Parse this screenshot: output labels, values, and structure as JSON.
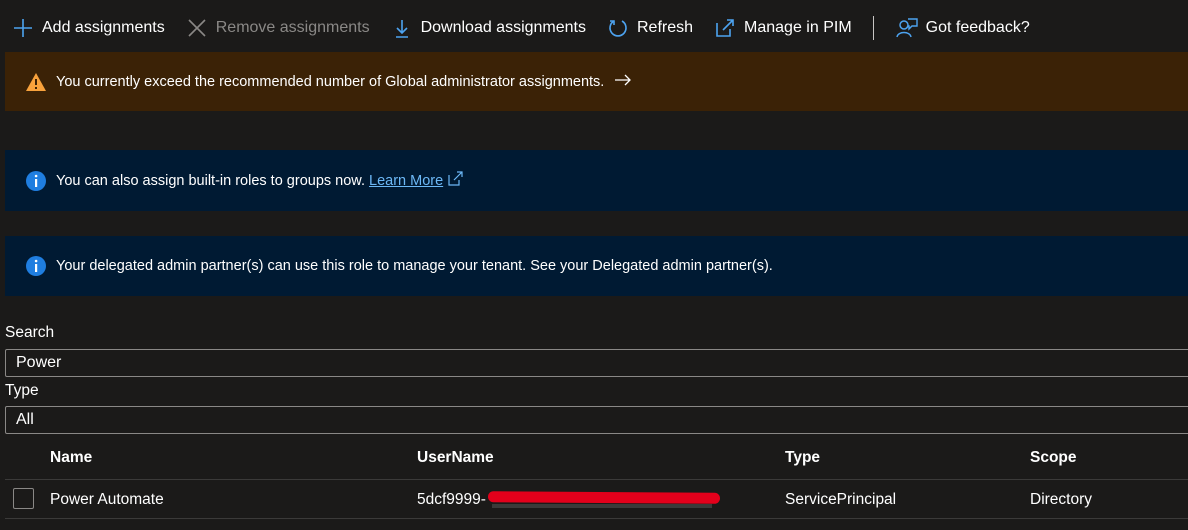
{
  "toolbar": {
    "add": "Add assignments",
    "remove": "Remove assignments",
    "download": "Download assignments",
    "refresh": "Refresh",
    "pim": "Manage in PIM",
    "feedback": "Got feedback?"
  },
  "banners": {
    "warning": "You currently exceed the recommended number of Global administrator assignments.",
    "groups_text": "You can also assign built-in roles to groups now.",
    "groups_link": "Learn More",
    "delegated": "Your delegated admin partner(s) can use this role to manage your tenant. See your Delegated admin partner(s)."
  },
  "filters": {
    "search_label": "Search",
    "search_value": "Power",
    "type_label": "Type",
    "type_value": "All"
  },
  "table": {
    "columns": [
      "Name",
      "UserName",
      "Type",
      "Scope"
    ],
    "rows": [
      {
        "name": "Power Automate",
        "username": "5dcf9999-",
        "type": "ServicePrincipal",
        "scope": "Directory"
      }
    ]
  },
  "colors": {
    "warning_bg": "#3b2206",
    "info_bg": "#001a33",
    "accent": "#0078d4",
    "redaction": "#e3001b"
  }
}
